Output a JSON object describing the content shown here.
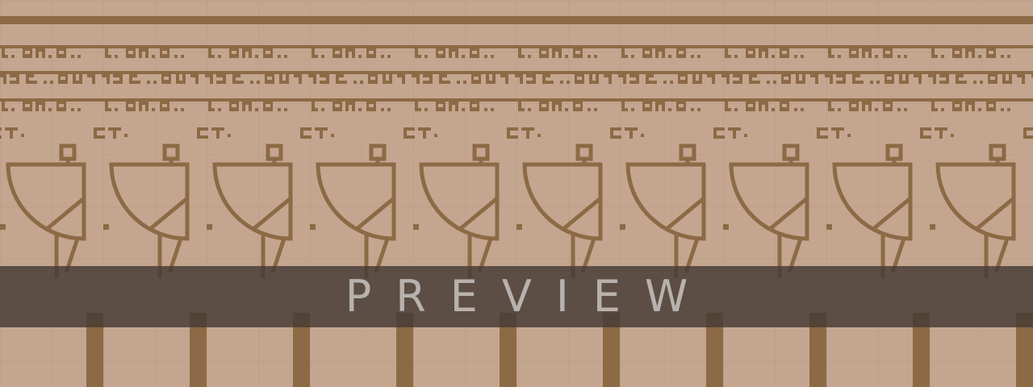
{
  "banner": {
    "label": "PREVIEW"
  },
  "colors": {
    "background": "#c4a690",
    "grid": "#b59a85",
    "ornament": "#8c6a45",
    "band": "#463a34",
    "label": "#b8b2ae"
  },
  "icons": {
    "motif": "quarter-circle-lamp-icon"
  }
}
